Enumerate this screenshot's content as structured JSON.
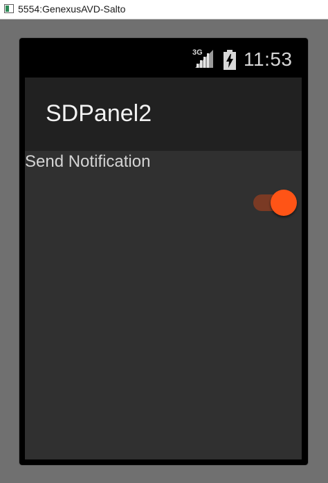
{
  "window": {
    "title": "5554:GenexusAVD-Salto"
  },
  "statusbar": {
    "network_type": "3G",
    "time": "11:53",
    "icons": [
      "signal-icon",
      "battery-charging-icon"
    ]
  },
  "actionbar": {
    "title": "SDPanel2"
  },
  "content": {
    "field_label": "Send Notification",
    "toggle": {
      "state": "on",
      "accent_color": "#ff5416",
      "track_color": "#7a3a24"
    }
  },
  "colors": {
    "window_background": "#707070",
    "actionbar_background": "#212121",
    "content_background": "#303030"
  }
}
